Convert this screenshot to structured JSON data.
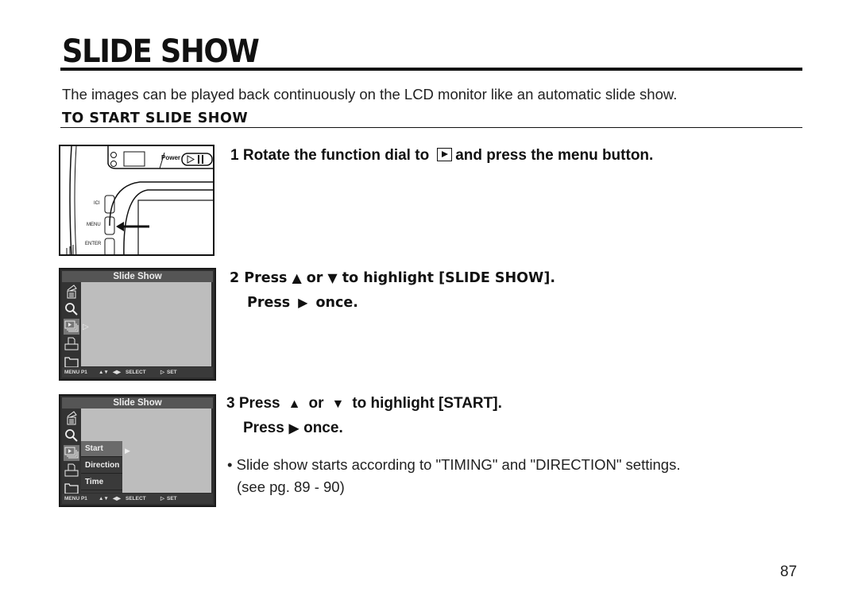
{
  "page": {
    "title": "SLIDE SHOW",
    "intro": "The images can be played back continuously on the LCD monitor like an automatic slide show.",
    "subheading": "TO START SLIDE SHOW",
    "page_number": "87"
  },
  "steps": [
    {
      "number": "1",
      "text_before_icon": "Rotate the function dial to",
      "icon": "playback-mode-icon",
      "text_after_icon": "and press the menu button."
    },
    {
      "number": "2",
      "line1": {
        "press": "Press",
        "up": "▲",
        "or": "or",
        "down": "▼",
        "rest": "to highlight [SLIDE SHOW]."
      },
      "line2": {
        "press": "Press",
        "right": "▶",
        "rest": "once."
      }
    },
    {
      "number": "3",
      "line1": {
        "press": "Press",
        "up": "▲",
        "or": "or",
        "down": "▼",
        "rest": "to highlight [START]."
      },
      "line2": {
        "press": "Press",
        "right": "▶",
        "rest": "once."
      },
      "note_line1": "• Slide show starts according to \"TIMING\" and \"DIRECTION\" settings.",
      "note_line2": "(see pg. 89 - 90)"
    }
  ],
  "camera_figure": {
    "power_label": "Power",
    "button_labels": [
      "ICI",
      "MENU",
      "ENTER"
    ]
  },
  "lcd_screens": [
    {
      "title": "Slide Show",
      "side_icons": [
        "delete-icon",
        "zoom-icon",
        "slideshow-icon",
        "print-icon",
        "folder-icon"
      ],
      "selected_icon_index": 2,
      "footer": {
        "page": "MENU P1",
        "nav": "▲▼",
        "select_arrows": "◀▶",
        "select": "SELECT",
        "set_arrow": "▷",
        "set": "SET"
      }
    },
    {
      "title": "Slide Show",
      "side_icons": [
        "delete-icon",
        "zoom-icon",
        "slideshow-icon",
        "print-icon",
        "folder-icon"
      ],
      "selected_icon_index": 2,
      "submenu": [
        "Start",
        "Direction",
        "Time"
      ],
      "selected_submenu_index": 0,
      "footer": {
        "page": "MENU P1",
        "nav": "▲▼",
        "select_arrows": "◀▶",
        "select": "SELECT",
        "set_arrow": "▷",
        "set": "SET"
      }
    }
  ]
}
